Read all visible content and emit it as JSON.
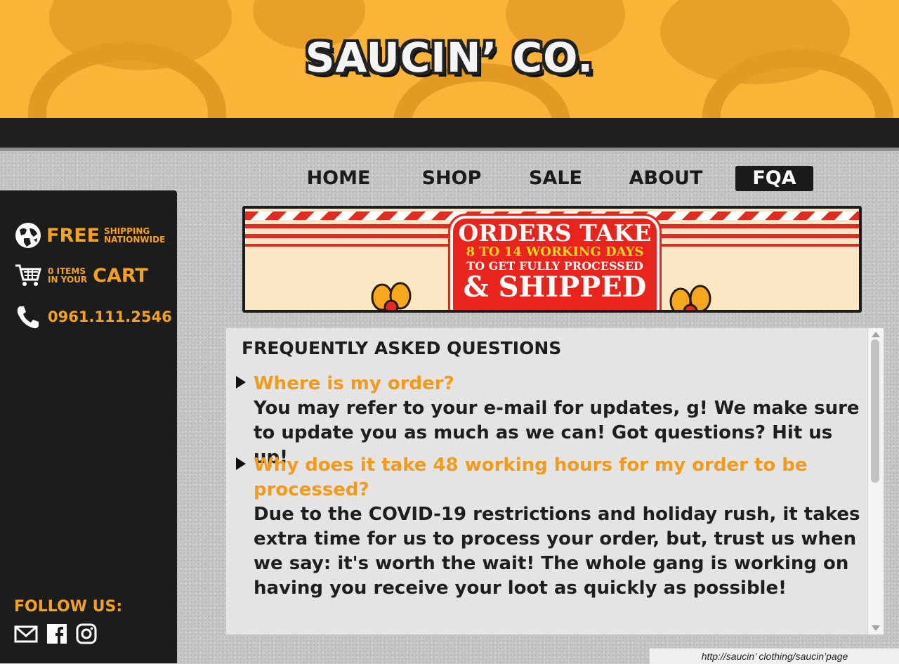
{
  "brand": {
    "logo_text": "SAUCIN’ CO."
  },
  "nav": {
    "items": [
      {
        "label": "HOME",
        "active": false
      },
      {
        "label": "SHOP",
        "active": false
      },
      {
        "label": "SALE",
        "active": false
      },
      {
        "label": "ABOUT",
        "active": false
      },
      {
        "label": "FQA",
        "active": true
      }
    ]
  },
  "sidebar": {
    "shipping": {
      "big": "FREE",
      "line1": "SHIPPING",
      "line2": "NATIONWIDE",
      "icon": "globe-icon"
    },
    "cart": {
      "count_line1": "0 ITEMS",
      "count_line2": "IN YOUR",
      "big": "CART",
      "icon": "cart-icon"
    },
    "phone": {
      "number": "0961.111.2546",
      "icon": "phone-icon"
    },
    "follow_label": "FOLLOW US:",
    "socials": [
      "mail-icon",
      "facebook-icon",
      "instagram-icon"
    ]
  },
  "banner": {
    "line1": "ORDERS TAKE",
    "line2": "8 TO 14 WORKING DAYS",
    "line3": "TO GET FULLY PROCESSED",
    "line4": "& SHIPPED"
  },
  "faq": {
    "title": "FREQUENTLY ASKED QUESTIONS",
    "items": [
      {
        "question": "Where is my order?",
        "answer": "You may refer to your e-mail for updates, g! We make sure to update you as much as we can! Got questions? Hit us up!"
      },
      {
        "question": "Why does it take 48 working hours for my order to be processed?",
        "answer": "Due to the COVID-19 restrictions and holiday rush, it takes extra time for us to process your order, but, trust us when we say: it's worth the wait! The whole gang is working on having you receive your loot as quickly as possible!"
      }
    ]
  },
  "status_url": "http://saucin’ clothing/saucin’page",
  "colors": {
    "accent": "#f49a1a",
    "header": "#fbb437",
    "dark": "#1c1c1c"
  }
}
